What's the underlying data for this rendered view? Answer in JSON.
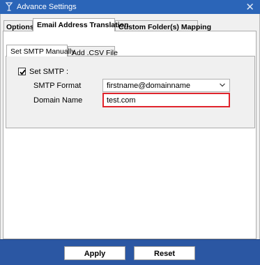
{
  "window": {
    "title": "Advance Settings",
    "close_glyph": "✕"
  },
  "tabs": [
    {
      "label": "Options"
    },
    {
      "label": "Email Address Translation"
    },
    {
      "label": "Custom Folder(s) Mapping"
    }
  ],
  "subtabs": [
    {
      "label": "Set SMTP Manually"
    },
    {
      "label": "Add .CSV File"
    }
  ],
  "smtp": {
    "checkbox_label": "Set SMTP :",
    "checked": true,
    "format_label": "SMTP Format",
    "format_value": "firstname@domainname",
    "domain_label": "Domain Name",
    "domain_value": "test.com"
  },
  "buttons": {
    "apply": "Apply",
    "reset": "Reset"
  },
  "colors": {
    "titlebar": "#2b65b8",
    "footer": "#2b57a3",
    "highlight": "#e0242c"
  },
  "icons": [
    "app-icon",
    "close-icon",
    "check-icon",
    "chevron-down-icon"
  ]
}
